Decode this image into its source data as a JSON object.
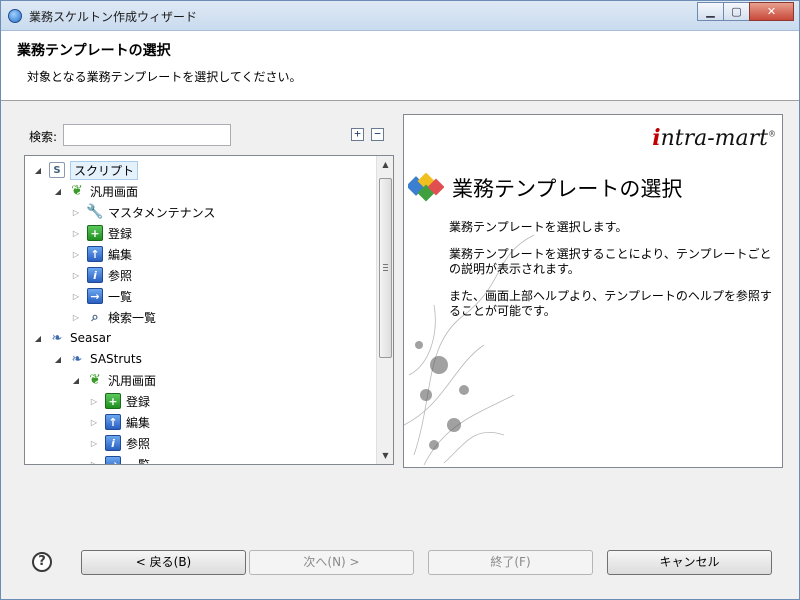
{
  "window": {
    "title": "業務スケルトン作成ウィザード",
    "minimize_glyph": "▁",
    "maximize_glyph": "▢",
    "close_glyph": "✕"
  },
  "header": {
    "title": "業務テンプレートの選択",
    "description": "対象となる業務テンプレートを選択してください。"
  },
  "search": {
    "label": "検索:",
    "value": "",
    "placeholder": "",
    "expand_all_glyph": "+",
    "collapse_all_glyph": "−"
  },
  "tree": {
    "items": [
      {
        "label": "スクリプト",
        "icon": "script-doc-icon",
        "glyph": "S",
        "expanded": true,
        "selected": true
      },
      {
        "label": "汎用画面",
        "icon": "leaf-icon",
        "glyph": "❦",
        "expanded": true
      },
      {
        "label": "マスタメンテナンス",
        "icon": "wrench-icon",
        "glyph": "🔧",
        "expanded": false
      },
      {
        "label": "登録",
        "icon": "add-icon",
        "glyph": "+",
        "expanded": false
      },
      {
        "label": "編集",
        "icon": "edit-icon",
        "glyph": "↑",
        "expanded": false
      },
      {
        "label": "参照",
        "icon": "info-icon",
        "glyph": "i",
        "expanded": false
      },
      {
        "label": "一覧",
        "icon": "list-icon",
        "glyph": "→",
        "expanded": false
      },
      {
        "label": "検索一覧",
        "icon": "search-list-icon",
        "glyph": "⌕",
        "expanded": false
      },
      {
        "label": "Seasar",
        "icon": "seasar-icon",
        "glyph": "❧",
        "expanded": true
      },
      {
        "label": "SAStruts",
        "icon": "sastruts-icon",
        "glyph": "❧",
        "expanded": true
      },
      {
        "label": "汎用画面",
        "icon": "leaf-icon",
        "glyph": "❦",
        "expanded": true
      },
      {
        "label": "登録",
        "icon": "add-icon",
        "glyph": "+",
        "expanded": false
      },
      {
        "label": "編集",
        "icon": "edit-icon",
        "glyph": "↑",
        "expanded": false
      },
      {
        "label": "参照",
        "icon": "info-icon",
        "glyph": "i",
        "expanded": false
      },
      {
        "label": "一覧",
        "icon": "list-icon",
        "glyph": "→",
        "expanded": false
      }
    ]
  },
  "description_panel": {
    "brand": "intra-mart",
    "brand_first_letter": "i",
    "brand_rest": "ntra-mart",
    "brand_mark": "®",
    "title": "業務テンプレートの選択",
    "paragraphs": [
      "業務テンプレートを選択します。",
      "業務テンプレートを選択することにより、テンプレートごとの説明が表示されます。",
      "また、画面上部ヘルプより、テンプレートのヘルプを参照することが可能です。"
    ],
    "brand_color": "#c00000"
  },
  "buttons": {
    "help_glyph": "?",
    "back": "< 戻る(B)",
    "next": "次へ(N) >",
    "finish": "終了(F)",
    "cancel": "キャンセル"
  }
}
